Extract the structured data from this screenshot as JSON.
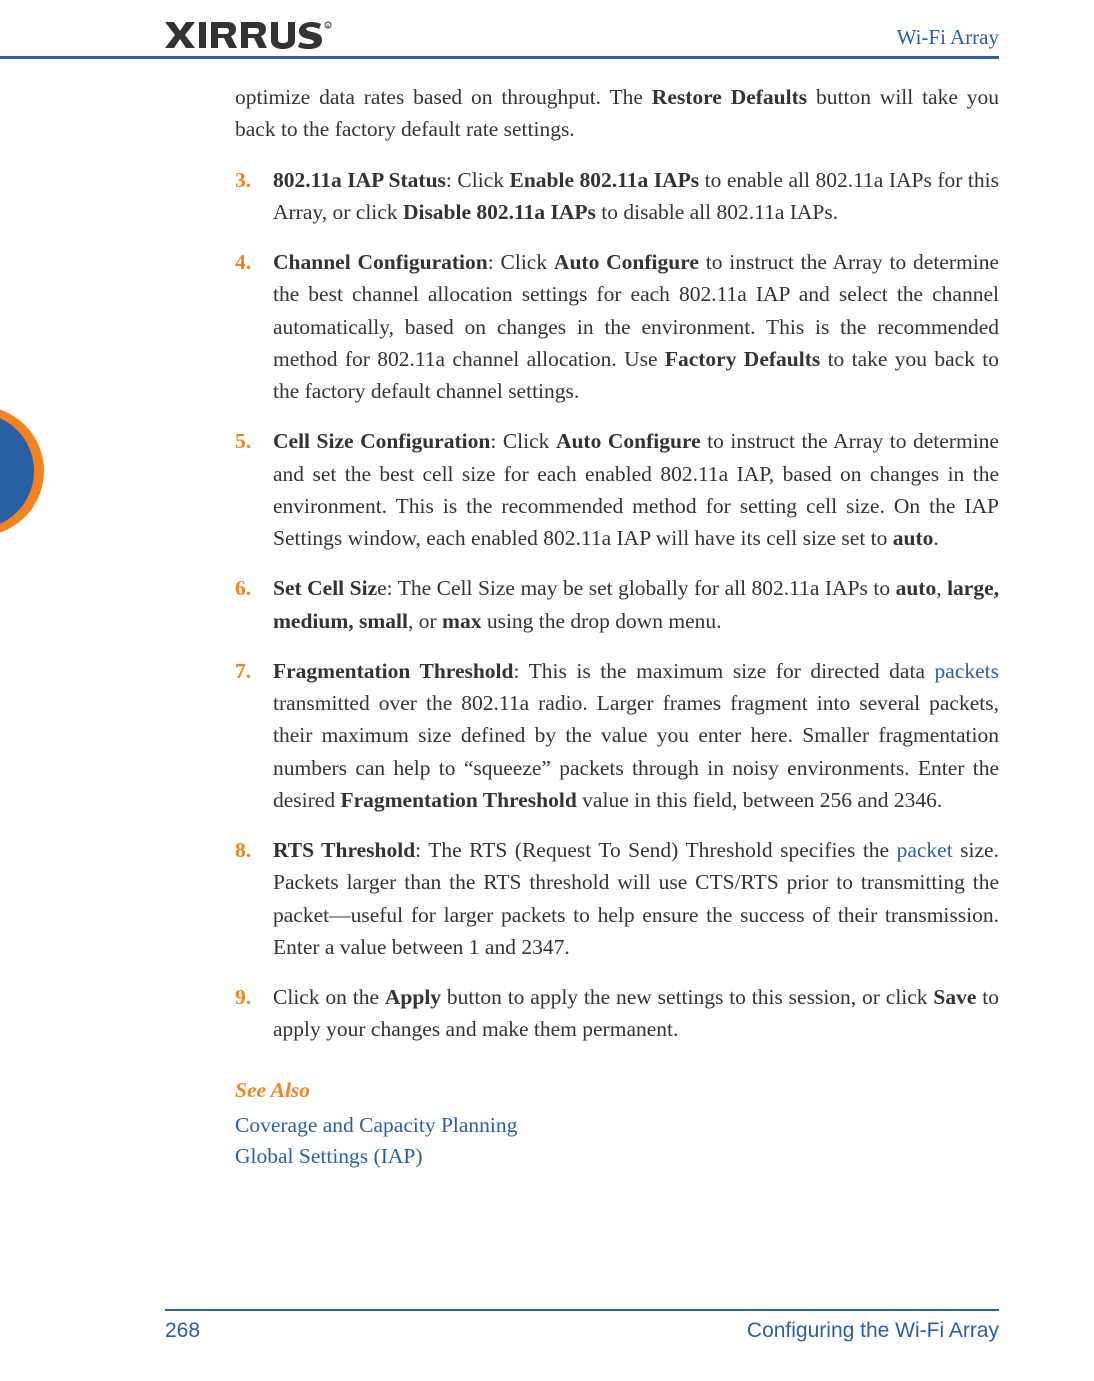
{
  "header": {
    "product": "Wi-Fi Array"
  },
  "intro": {
    "pre": "optimize data rates based on throughput. The ",
    "bold": "Restore Defaults",
    "post": " button will take you back to the factory default rate settings."
  },
  "items": [
    {
      "num": "3.",
      "parts": [
        {
          "b": true,
          "t": "802.11a IAP Status"
        },
        {
          "t": ": Click "
        },
        {
          "b": true,
          "t": "Enable 802.11a IAPs"
        },
        {
          "t": " to enable all 802.11a IAPs for this Array, or click "
        },
        {
          "b": true,
          "t": "Disable 802.11a IAPs"
        },
        {
          "t": " to disable all 802.11a IAPs."
        }
      ]
    },
    {
      "num": "4.",
      "parts": [
        {
          "b": true,
          "t": "Channel Configuration"
        },
        {
          "t": ": Click "
        },
        {
          "b": true,
          "t": "Auto Configure"
        },
        {
          "t": " to instruct the Array to determine the best channel allocation settings for each 802.11a IAP and select the channel automatically, based on changes in the environment. This is the recommended method for 802.11a channel allocation. Use "
        },
        {
          "b": true,
          "t": "Factory Defaults"
        },
        {
          "t": " to take you back to the factory default channel settings."
        }
      ]
    },
    {
      "num": "5.",
      "parts": [
        {
          "b": true,
          "t": "Cell Size Configuration"
        },
        {
          "t": ": Click "
        },
        {
          "b": true,
          "t": "Auto Configure"
        },
        {
          "t": " to instruct the Array to determine and set the best cell size for each enabled 802.11a IAP, based on changes in the environment. This is the recommended method for setting cell size. On the IAP Settings window, each enabled 802.11a IAP will have its cell size set to "
        },
        {
          "b": true,
          "t": "auto"
        },
        {
          "t": "."
        }
      ]
    },
    {
      "num": "6.",
      "parts": [
        {
          "b": true,
          "t": "Set Cell Siz"
        },
        {
          "t": "e: The Cell Size may be set globally for all 802.11a IAPs to "
        },
        {
          "b": true,
          "t": "auto"
        },
        {
          "t": ", "
        },
        {
          "b": true,
          "t": "large, medium, small"
        },
        {
          "t": ", or "
        },
        {
          "b": true,
          "t": "max"
        },
        {
          "t": " using the drop down menu."
        }
      ]
    },
    {
      "num": "7.",
      "parts": [
        {
          "b": true,
          "t": "Fragmentation Threshold"
        },
        {
          "t": ": This is the maximum size for directed data "
        },
        {
          "link": true,
          "t": "packets"
        },
        {
          "t": " transmitted over the 802.11a radio. Larger frames fragment into several packets, their maximum size defined by the value you enter here. Smaller fragmentation numbers can help to “squeeze” packets through in noisy environments. Enter the desired "
        },
        {
          "b": true,
          "t": "Fragmentation Threshold"
        },
        {
          "t": " value in this field, between 256 and 2346."
        }
      ]
    },
    {
      "num": "8.",
      "parts": [
        {
          "b": true,
          "t": "RTS Threshold"
        },
        {
          "t": ": The RTS (Request To Send) Threshold specifies the "
        },
        {
          "link": true,
          "t": "packet"
        },
        {
          "t": " size. Packets larger than the RTS threshold will use CTS/RTS prior to transmitting the packet—useful for larger packets to help ensure the success of their transmission. Enter a value between 1 and 2347."
        }
      ]
    },
    {
      "num": "9.",
      "parts": [
        {
          "t": "Click on the "
        },
        {
          "b": true,
          "t": "Apply"
        },
        {
          "t": " button to apply the new settings to this session, or click "
        },
        {
          "b": true,
          "t": "Save"
        },
        {
          "t": " to apply your changes and make them permanent."
        }
      ]
    }
  ],
  "seeAlso": {
    "heading": "See Also",
    "links": [
      "Coverage and Capacity Planning",
      "Global Settings (IAP)"
    ]
  },
  "footer": {
    "page": "268",
    "section": "Configuring the Wi-Fi Array"
  }
}
